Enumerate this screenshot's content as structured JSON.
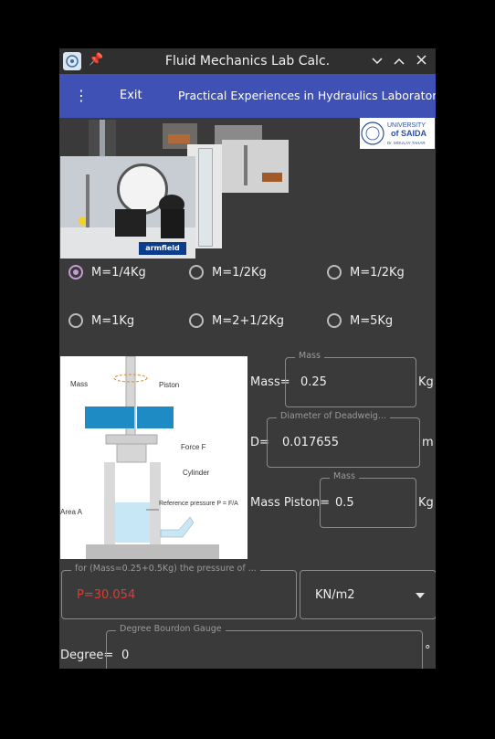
{
  "window": {
    "title": "Fluid Mechanics Lab Calc.",
    "controls": [
      "chevron-down",
      "chevron-up",
      "close"
    ]
  },
  "appbar": {
    "menu_glyph": "⋮",
    "exit_label": "Exit",
    "title": "Practical Experiences in Hydraulics Laboratory"
  },
  "logo": {
    "line1": "UNIVERSITY",
    "line2": "of SAIDA",
    "line3": "Dr. MOULAY TAHAR"
  },
  "photo_brand": "armfield",
  "mass_options": [
    {
      "label": "M=1/4Kg",
      "selected": true
    },
    {
      "label": "M=1/2Kg",
      "selected": false
    },
    {
      "label": "M=1/2Kg",
      "selected": false
    },
    {
      "label": "M=1Kg",
      "selected": false
    },
    {
      "label": "M=2+1/2Kg",
      "selected": false
    },
    {
      "label": "M=5Kg",
      "selected": false
    }
  ],
  "diagram_labels": {
    "mass": "Mass",
    "piston": "Piston",
    "force": "Force F",
    "cylinder": "Cylinder",
    "area": "Area A",
    "ref_pressure": "Reference pressure P = F/A"
  },
  "form": {
    "mass": {
      "label": "Mass=",
      "legend": "Mass",
      "value": "0.25",
      "unit": "Kg"
    },
    "diameter": {
      "label": "D=",
      "legend": "Diameter of Deadweig...",
      "value": "0.017655",
      "unit": "m"
    },
    "mass_piston": {
      "label": "Mass Piston=",
      "legend": "Mass",
      "value": "0.5",
      "unit": "Kg"
    },
    "pressure": {
      "legend": "for (Mass=0.25+0.5Kg) the pressure of ...",
      "value": "P=30.054",
      "value_color": "#e53935"
    },
    "unit_select": {
      "value": "KN/m2"
    },
    "degree": {
      "label": "Degree=",
      "legend": "Degree Bourdon Gauge",
      "value": "0",
      "unit": "°"
    }
  },
  "colors": {
    "appbar": "#3f51b5",
    "radio_accent": "#c79bd8",
    "error_text": "#e53935"
  }
}
